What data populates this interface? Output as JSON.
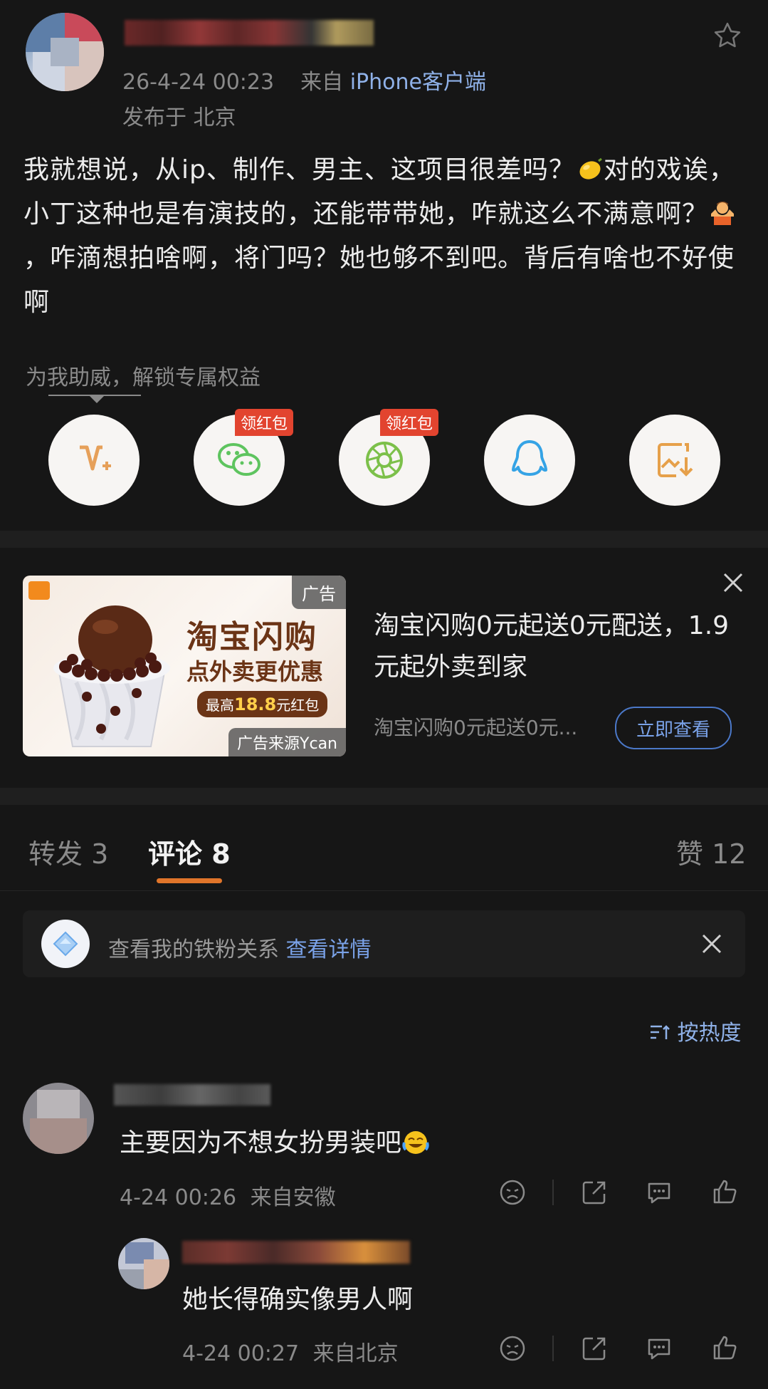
{
  "post": {
    "time": "26-4-24 00:23",
    "source_prefix": "来自",
    "source": "iPhone客户端",
    "location": "发布于 北京",
    "text_parts": [
      "我就想说，从ip、制作、男主、这项目很差吗？",
      "对的戏诶，小丁这种也是有演技的，还能带带她，咋就这么不满意啊？",
      "，咋滴想拍啥啊，将门吗？她也够不到吧。背后有啥也不好使啊"
    ],
    "emoji1": "lemon-emoji",
    "emoji2": "person-shrugging-emoji"
  },
  "support": {
    "text": "为我助威，解锁专属权益"
  },
  "share": {
    "buttons": [
      {
        "icon": "vip-plus-icon",
        "badge": ""
      },
      {
        "icon": "wechat-icon",
        "badge": "领红包"
      },
      {
        "icon": "moments-icon",
        "badge": "领红包"
      },
      {
        "icon": "qq-icon",
        "badge": ""
      },
      {
        "icon": "save-image-icon",
        "badge": ""
      }
    ]
  },
  "ad": {
    "tag": "广告",
    "source": "广告来源Ycan",
    "img_title1": "淘宝闪购",
    "img_title2": "点外卖更优惠",
    "img_pill_prefix": "最高",
    "img_pill_amount": "18.8",
    "img_pill_suffix": "元红包",
    "headline": "淘宝闪购0元起送0元配送，1.9元起外卖到家",
    "desc": "淘宝闪购0元起送0元...",
    "cta": "立即查看"
  },
  "tabs": {
    "repost": "转发 3",
    "comments": "评论 8",
    "likes": "赞 12"
  },
  "fans": {
    "text": "查看我的铁粉关系",
    "link": "查看详情"
  },
  "sort": {
    "label": "按热度"
  },
  "comments": [
    {
      "text": "主要因为不想女扮男装吧",
      "emoji": "laughing-crying-emoji",
      "time": "4-24 00:26",
      "location": "来自安徽"
    },
    {
      "text": "她长得确实像男人啊",
      "time": "4-24 00:27",
      "location": "来自北京"
    }
  ],
  "colors": {
    "background": "#161616",
    "accent_orange": "#e0752a",
    "link_blue": "#7aa2e8",
    "badge_red": "#e2442f"
  }
}
